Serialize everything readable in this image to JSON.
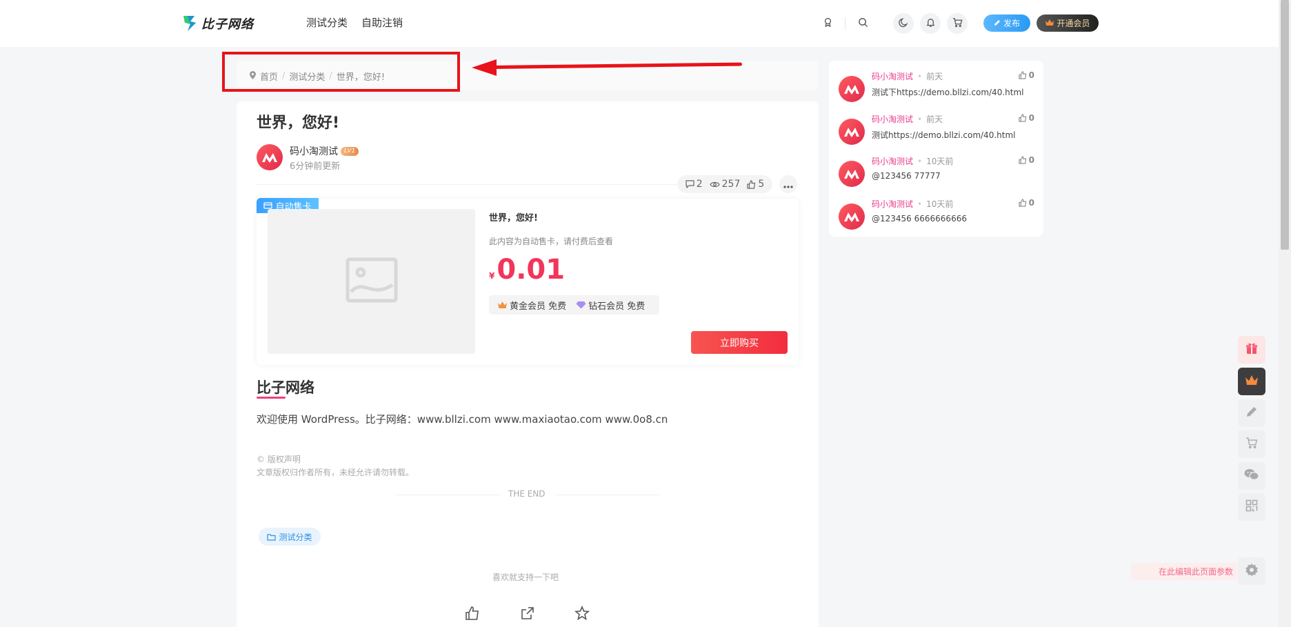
{
  "header": {
    "logo_text": "比子网络",
    "nav": [
      "测试分类",
      "自助注销"
    ],
    "publish_label": "发布",
    "vip_label": "开通会员"
  },
  "breadcrumb": {
    "home": "首页",
    "category": "测试分类",
    "current": "世界，您好!"
  },
  "post": {
    "title": "世界，您好!",
    "author": "码小淘测试",
    "level": "LV1",
    "updated": "6分钟前更新",
    "comments": "2",
    "views": "257",
    "likes": "5"
  },
  "product": {
    "tag": "自动售卡",
    "title": "世界，您好!",
    "desc": "此内容为自动售卡，请付费后查看",
    "currency": "¥",
    "price": "0.01",
    "gold_vip": "黄金会员 免费",
    "diamond_vip": "钻石会员 免费",
    "buy_label": "立即购买"
  },
  "content": {
    "section_title": "比子网络",
    "body": "欢迎使用 WordPress。比子网络：www.bllzi.com www.maxiaotao.com www.0o8.cn",
    "copyright_title": "© 版权声明",
    "copyright_text": "文章版权归作者所有，未经允许请勿转载。",
    "end": "THE END",
    "category_tag": "测试分类",
    "like_tip": "喜欢就支持一下吧"
  },
  "sidebar": {
    "comments": [
      {
        "name": "码小淘测试",
        "when": "前天",
        "likes": "0",
        "text": "测试下https://demo.bllzi.com/40.html"
      },
      {
        "name": "码小淘测试",
        "when": "前天",
        "likes": "0",
        "text": "测试https://demo.bllzi.com/40.html"
      },
      {
        "name": "码小淘测试",
        "when": "10天前",
        "likes": "0",
        "text": "@123456 77777"
      },
      {
        "name": "码小淘测试",
        "when": "10天前",
        "likes": "0",
        "text": "@123456 6666666666"
      }
    ]
  },
  "tools": {
    "edit_tip": "在此编辑此页面参数"
  },
  "colors": {
    "annotation_red": "#e8131b",
    "price": "#f2355b",
    "accent_pink": "#e93b8b",
    "primary_blue": "#2b9af3"
  }
}
